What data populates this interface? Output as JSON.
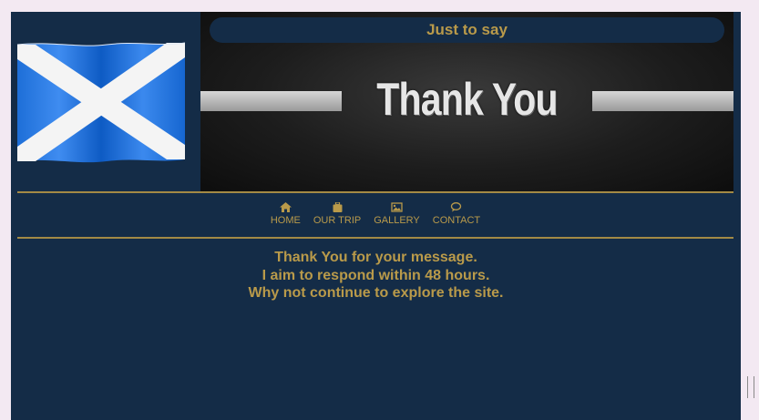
{
  "banner": {
    "heading": "Just to say",
    "image_text": "Thank You"
  },
  "nav": {
    "items": [
      {
        "label": "HOME",
        "icon": "home-icon"
      },
      {
        "label": "OUR TRIP",
        "icon": "suitcase-icon"
      },
      {
        "label": "GALLERY",
        "icon": "image-icon"
      },
      {
        "label": "CONTACT",
        "icon": "chat-icon"
      }
    ]
  },
  "message": {
    "line1": "Thank You for your message.",
    "line2": "I aim to respond within 48 hours.",
    "line3": "Why not continue to explore the site."
  },
  "colors": {
    "background": "#142c47",
    "accent": "#b99a4a",
    "page": "#f3e9f2"
  }
}
